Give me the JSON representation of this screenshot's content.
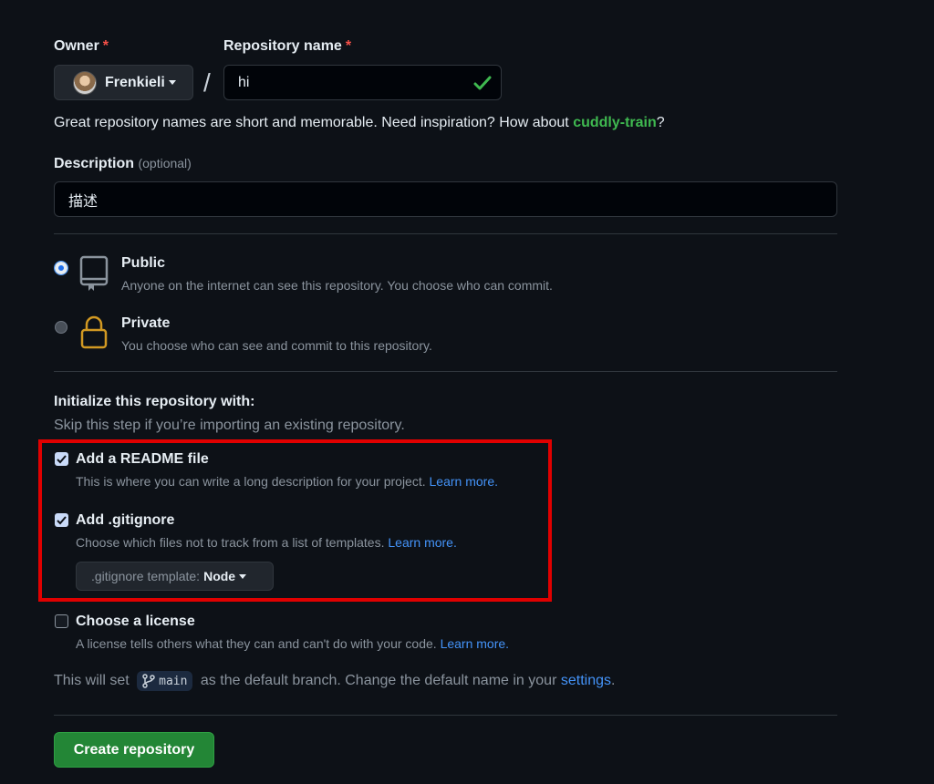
{
  "owner": {
    "label": "Owner",
    "required_mark": "*",
    "name": "Frenkieli"
  },
  "repository": {
    "label": "Repository name",
    "required_mark": "*",
    "separator": "/",
    "value": "hi",
    "hint_prefix": "Great repository names are short and memorable. Need inspiration? How about ",
    "suggestion": "cuddly-train",
    "hint_suffix": "?"
  },
  "description": {
    "label": "Description",
    "optional": "(optional)",
    "value": "描述"
  },
  "visibility": {
    "public": {
      "title": "Public",
      "desc": "Anyone on the internet can see this repository. You choose who can commit.",
      "selected": true
    },
    "private": {
      "title": "Private",
      "desc": "You choose who can see and commit to this repository.",
      "selected": false
    }
  },
  "init": {
    "heading": "Initialize this repository with:",
    "subheading": "Skip this step if you’re importing an existing repository.",
    "readme": {
      "title": "Add a README file",
      "desc": "This is where you can write a long description for your project.",
      "link": "Learn more.",
      "checked": true
    },
    "gitignore": {
      "title": "Add .gitignore",
      "desc": "Choose which files not to track from a list of templates.",
      "link": "Learn more.",
      "checked": true,
      "template_label": ".gitignore template:",
      "template_value": "Node"
    },
    "license": {
      "title": "Choose a license",
      "desc": "A license tells others what they can and can't do with your code.",
      "link": "Learn more.",
      "checked": false
    }
  },
  "branch": {
    "prefix": "This will set",
    "name": "main",
    "middle": "as the default branch. Change the default name in your",
    "link": "settings",
    "suffix": "."
  },
  "create_button": "Create repository",
  "colors": {
    "accent_green": "#238636",
    "link_blue": "#4493f8",
    "suggestion_green": "#3fb950",
    "highlight_red": "#e00000"
  },
  "icons": [
    "repo-icon",
    "lock-icon",
    "check-icon",
    "git-branch-icon",
    "caret-down-icon"
  ]
}
